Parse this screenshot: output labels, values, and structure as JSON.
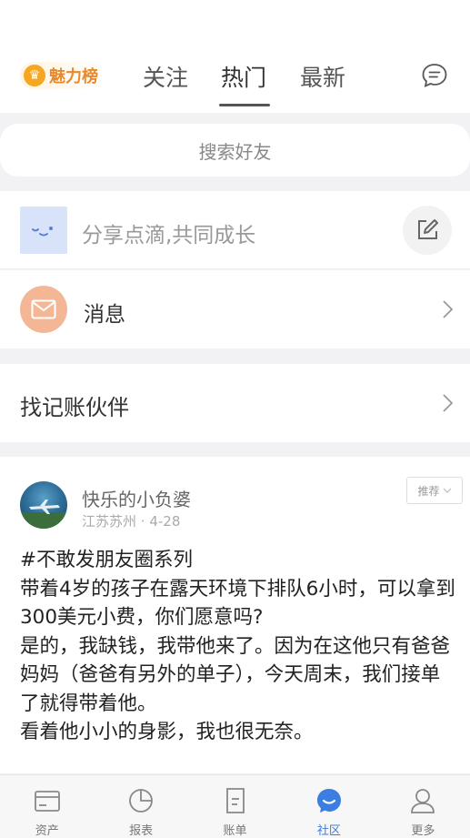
{
  "header": {
    "charm_label": "魅力榜",
    "tabs": [
      {
        "label": "关注",
        "active": false
      },
      {
        "label": "热门",
        "active": true
      },
      {
        "label": "最新",
        "active": false
      }
    ]
  },
  "search": {
    "placeholder": "搜索好友"
  },
  "share": {
    "placeholder": "分享点滴,共同成长"
  },
  "messages": {
    "label": "消息"
  },
  "partner": {
    "label": "找记账伙伴"
  },
  "post": {
    "username": "快乐的小负婆",
    "location": "江苏苏州",
    "date": "4-28",
    "tag": "推荐",
    "lines": [
      "#不敢发朋友圈系列",
      "带着4岁的孩子在露天环境下排队6小时，可以拿到300美元小费，你们愿意吗?",
      "是的，我缺钱，我带他来了。因为在这他只有爸爸妈妈（爸爸有另外的单子），今天周末，我们接单了就得带着他。",
      "看着他小小的身影，我也很无奈。"
    ]
  },
  "bottom_nav": [
    {
      "label": "资产",
      "icon": "wallet-icon",
      "active": false
    },
    {
      "label": "报表",
      "icon": "pie-chart-icon",
      "active": false
    },
    {
      "label": "账单",
      "icon": "bill-icon",
      "active": false
    },
    {
      "label": "社区",
      "icon": "community-chat-icon",
      "active": true
    },
    {
      "label": "更多",
      "icon": "person-icon",
      "active": false
    }
  ],
  "colors": {
    "accent": "#3b7de0",
    "charm": "#e8892b",
    "message_icon_bg": "#f4b796",
    "page_bg": "#f2f2f5"
  }
}
